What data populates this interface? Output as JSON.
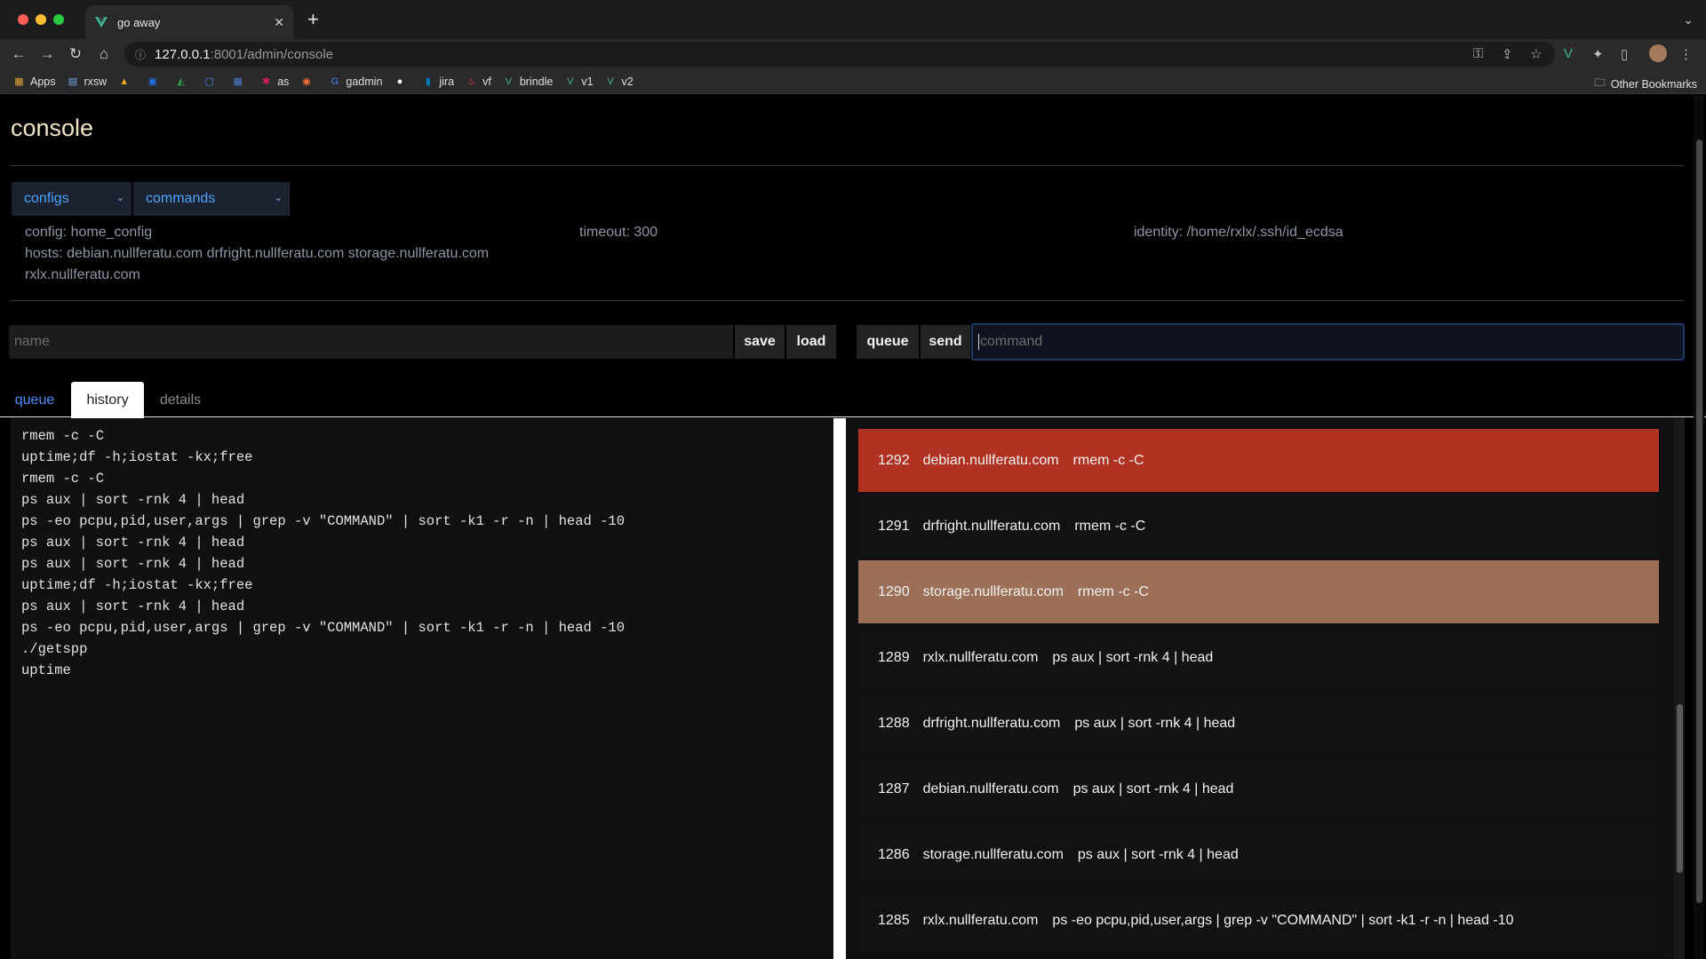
{
  "browser": {
    "tab_title": "go away",
    "url_host": "127.0.0.1",
    "url_path": ":8001/admin/console",
    "bookmarks": [
      {
        "label": "Apps",
        "icon": "apps-grid-icon",
        "color": "#e8a33a"
      },
      {
        "label": "rxsw",
        "icon": "rxsw-icon",
        "color": "#7aa6e8"
      },
      {
        "label": "",
        "icon": "firebase-icon",
        "color": "#f5a623"
      },
      {
        "label": "",
        "icon": "calendar-icon",
        "color": "#1a73e8"
      },
      {
        "label": "",
        "icon": "drive-icon",
        "color": "#34a853"
      },
      {
        "label": "",
        "icon": "square-app-icon",
        "color": "#5b8def"
      },
      {
        "label": "",
        "icon": "grid-app-icon",
        "color": "#4c7bd9"
      },
      {
        "label": "as",
        "icon": "slack-icon",
        "color": "#e01e5a"
      },
      {
        "label": "",
        "icon": "firefox-icon",
        "color": "#ff7139"
      },
      {
        "label": "gadmin",
        "icon": "google-icon",
        "color": "#4285f4"
      },
      {
        "label": "",
        "icon": "github-icon",
        "color": "#ffffff"
      },
      {
        "label": "jira",
        "icon": "trello-icon",
        "color": "#0079bf"
      },
      {
        "label": "vf",
        "icon": "flame-icon",
        "color": "#ff4a3d"
      },
      {
        "label": "brindle",
        "icon": "vue-icon",
        "color": "#42b883"
      },
      {
        "label": "v1",
        "icon": "vue-icon",
        "color": "#42b883"
      },
      {
        "label": "v2",
        "icon": "vue-icon",
        "color": "#42b883"
      }
    ],
    "other_bookmarks": "Other Bookmarks"
  },
  "page": {
    "title": "console",
    "configs_select": "configs",
    "commands_select": "commands",
    "config_line": "config: home_config",
    "hosts_line1": "hosts: debian.nullferatu.com drfright.nullferatu.com storage.nullferatu.com",
    "hosts_line2": "rxlx.nullferatu.com",
    "timeout": "timeout: 300",
    "identity": "identity: /home/rxlx/.ssh/id_ecdsa",
    "name_placeholder": "name",
    "save_label": "save",
    "load_label": "load",
    "queue_btn_label": "queue",
    "send_label": "send",
    "command_placeholder": "command",
    "tabs": [
      "queue",
      "history",
      "details"
    ]
  },
  "history_commands": [
    "rmem -c -C",
    "uptime;df -h;iostat -kx;free",
    "rmem -c -C",
    "ps aux | sort -rnk 4 | head",
    "ps -eo pcpu,pid,user,args | grep -v \"COMMAND\" | sort -k1 -r -n | head -10",
    "ps aux | sort -rnk 4 | head",
    "ps aux | sort -rnk 4 | head",
    "uptime;df -h;iostat -kx;free",
    "ps aux | sort -rnk 4 | head",
    "ps -eo pcpu,pid,user,args | grep -v \"COMMAND\" | sort -k1 -r -n | head -10",
    "./getspp",
    "uptime"
  ],
  "results": [
    {
      "id": "1292",
      "host": "debian.nullferatu.com",
      "cmd": "rmem -c -C",
      "bg": "#b03222"
    },
    {
      "id": "1291",
      "host": "drfright.nullferatu.com",
      "cmd": "rmem -c -C",
      "bg": "#121214"
    },
    {
      "id": "1290",
      "host": "storage.nullferatu.com",
      "cmd": "rmem -c -C",
      "bg": "#9c7058"
    },
    {
      "id": "1289",
      "host": "rxlx.nullferatu.com",
      "cmd": "ps aux | sort -rnk 4 | head",
      "bg": "#121214"
    },
    {
      "id": "1288",
      "host": "drfright.nullferatu.com",
      "cmd": "ps aux | sort -rnk 4 | head",
      "bg": "#121214"
    },
    {
      "id": "1287",
      "host": "debian.nullferatu.com",
      "cmd": "ps aux | sort -rnk 4 | head",
      "bg": "#121214"
    },
    {
      "id": "1286",
      "host": "storage.nullferatu.com",
      "cmd": "ps aux | sort -rnk 4 | head",
      "bg": "#121214"
    },
    {
      "id": "1285",
      "host": "rxlx.nullferatu.com",
      "cmd": "ps -eo pcpu,pid,user,args | grep -v \"COMMAND\" | sort -k1 -r -n | head -10",
      "bg": "#121214"
    }
  ]
}
